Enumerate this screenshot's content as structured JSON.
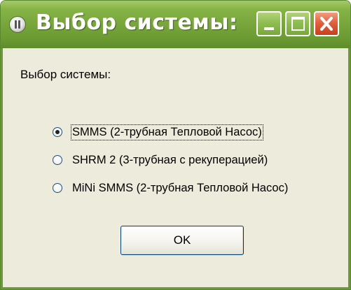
{
  "window": {
    "title": "Выбор системы:",
    "icon": "app-icon"
  },
  "titlebar_buttons": {
    "minimize_icon": "minimize-icon",
    "maximize_icon": "maximize-icon",
    "close_icon": "close-icon"
  },
  "dialog": {
    "label": "Выбор системы:",
    "options": [
      {
        "label": "SMMS (2-трубная Тепловой Насос)",
        "checked": true
      },
      {
        "label": "SHRM 2 (3-трубная с рекуперацией)",
        "checked": false
      },
      {
        "label": "MiNi SMMS (2-трубная Тепловой Насос)",
        "checked": false
      }
    ],
    "ok_label": "OK"
  },
  "colors": {
    "titlebar": "#78a63c",
    "client_background": "#ecebdc",
    "close_button": "#e06040"
  }
}
